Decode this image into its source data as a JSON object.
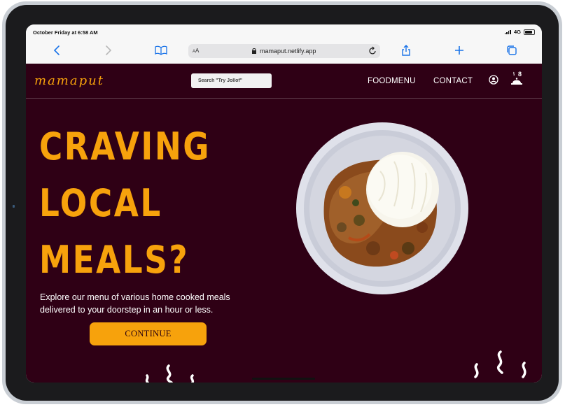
{
  "status_bar": {
    "datetime": "October Friday at 6:58 AM",
    "network": "4G"
  },
  "browser": {
    "reader_label_small": "A",
    "reader_label_large": "A",
    "url": "mamaput.netlify.app",
    "icons": [
      "back-icon",
      "forward-icon",
      "bookmarks-icon",
      "lock-icon",
      "reload-icon",
      "share-icon",
      "new-tab-icon",
      "tabs-icon"
    ]
  },
  "site": {
    "logo": "mamaput",
    "search_placeholder": "Search \"Try Jollof\"",
    "nav": {
      "food_menu": "FOODMENU",
      "contact": "CONTACT",
      "cart_count": "8"
    },
    "hero": {
      "line1": "CRAVING",
      "line2": "LOCAL",
      "line3": "MEALS?",
      "description": "Explore our menu of various home cooked meals delivered to your doorstep in an hour or less.",
      "cta": "CONTINUE"
    },
    "colors": {
      "background": "#2f0015",
      "accent": "#f7a20c",
      "text": "#ffffff"
    }
  }
}
